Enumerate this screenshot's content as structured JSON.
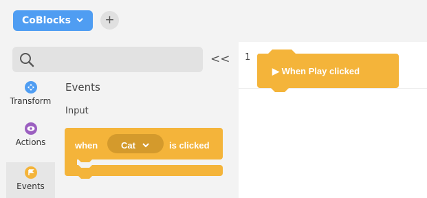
{
  "header": {
    "project_button": {
      "label": "CoBlocks",
      "chevron": "chevron-down-icon"
    },
    "add_button": {
      "icon": "plus-icon",
      "label": "+"
    }
  },
  "palette": {
    "search_icon": "search-icon",
    "collapse_label": "<<",
    "categories": [
      {
        "label": "Transform",
        "icon": "move-arrows-icon",
        "color": "#4f9df2"
      },
      {
        "label": "Actions",
        "icon": "eye-icon",
        "color": "#9b5fc0"
      },
      {
        "label": "Events",
        "icon": "flag-icon",
        "color": "#f4b43a",
        "active": true
      }
    ],
    "section_title": "Events",
    "section_subtitle": "Input",
    "event_block": {
      "when": "when",
      "target": "Cat",
      "suffix": "is clicked"
    }
  },
  "canvas": {
    "line_number": "1",
    "play_block_label": "▶ When Play clicked"
  },
  "colors": {
    "primary": "#4f9df2",
    "block": "#f4b43a",
    "block_dark": "#d49a2c",
    "canvas": "#ffffff"
  }
}
